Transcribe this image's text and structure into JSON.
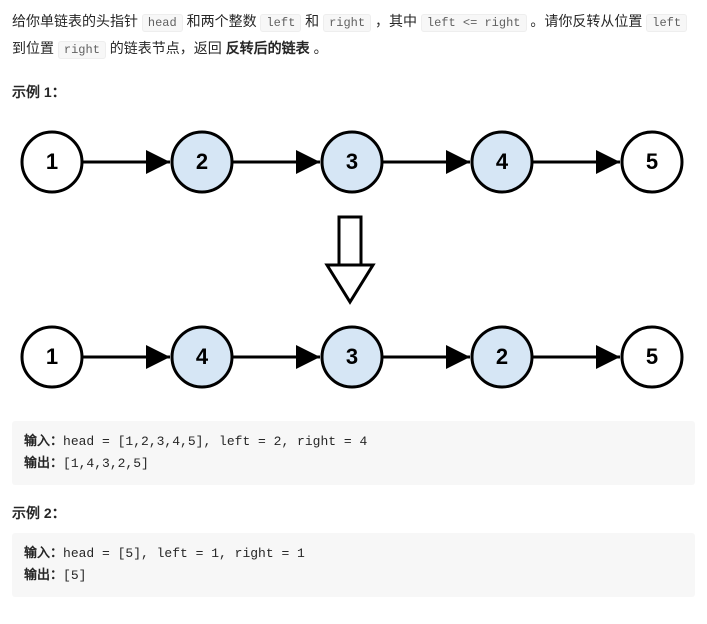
{
  "desc": {
    "t1": "给你单链表的头指针 ",
    "c1": "head",
    "t2": " 和两个整数 ",
    "c2": "left",
    "t3": " 和 ",
    "c3": "right",
    "t4": " ，其中 ",
    "c4": "left <= right",
    "t5": " 。请你反转从位置 ",
    "c5": "left",
    "t6": " 到位置 ",
    "c6": "right",
    "t7": " 的链表节点，返回 ",
    "bold": "反转后的链表",
    "t8": " 。"
  },
  "ex1_heading": "示例 1：",
  "diagram": {
    "top": [
      "1",
      "2",
      "3",
      "4",
      "5"
    ],
    "bottom": [
      "1",
      "4",
      "3",
      "2",
      "5"
    ],
    "highlight_fill": "#d6e6f5",
    "white_fill": "#ffffff",
    "stroke": "#000000"
  },
  "ex1": {
    "in_label": "输入：",
    "in_value": "head = [1,2,3,4,5], left = 2, right = 4",
    "out_label": "输出：",
    "out_value": "[1,4,3,2,5]"
  },
  "ex2_heading": "示例 2：",
  "ex2": {
    "in_label": "输入：",
    "in_value": "head = [5], left = 1, right = 1",
    "out_label": "输出：",
    "out_value": "[5]"
  }
}
